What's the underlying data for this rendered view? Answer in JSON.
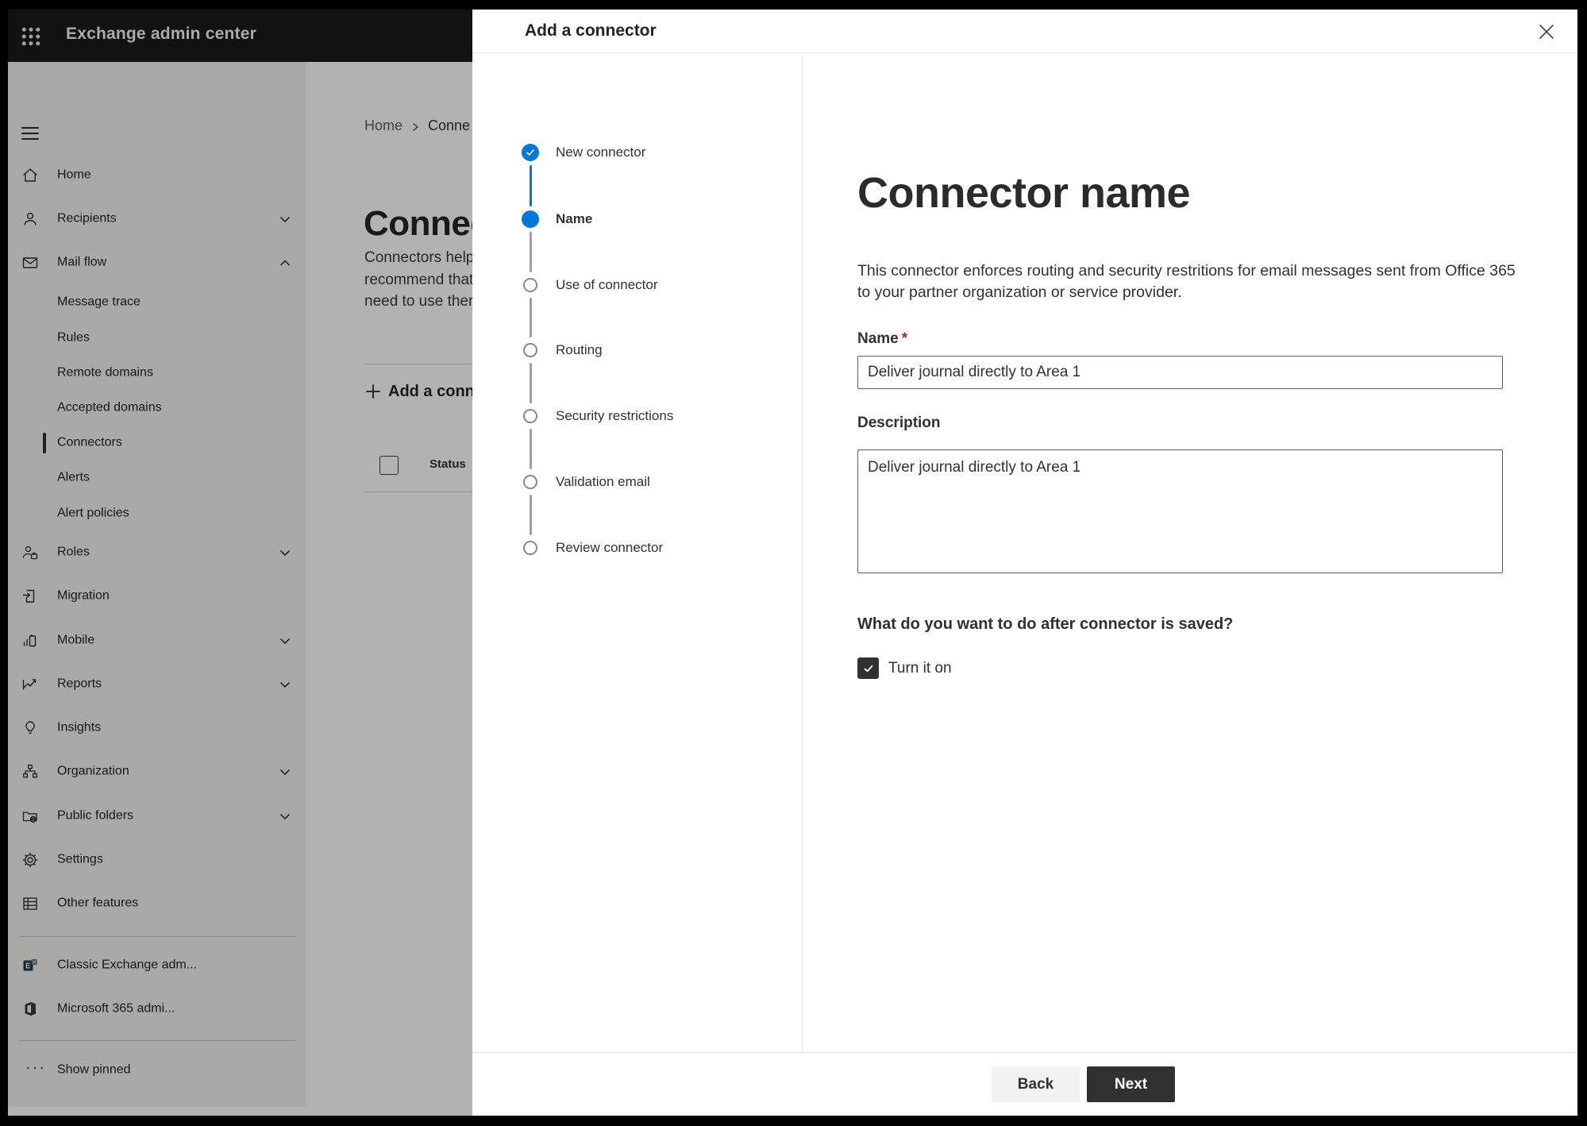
{
  "topbar": {
    "title": "Exchange admin center"
  },
  "sidebar": {
    "nav": [
      {
        "label": "Home"
      },
      {
        "label": "Recipients"
      },
      {
        "label": "Mail flow"
      },
      {
        "label": "Message trace"
      },
      {
        "label": "Rules"
      },
      {
        "label": "Remote domains"
      },
      {
        "label": "Accepted domains"
      },
      {
        "label": "Connectors",
        "selected": true
      },
      {
        "label": "Alerts"
      },
      {
        "label": "Alert policies"
      },
      {
        "label": "Roles"
      },
      {
        "label": "Migration"
      },
      {
        "label": "Mobile"
      },
      {
        "label": "Reports"
      },
      {
        "label": "Insights"
      },
      {
        "label": "Organization"
      },
      {
        "label": "Public folders"
      },
      {
        "label": "Settings"
      },
      {
        "label": "Other features"
      },
      {
        "label": "Classic Exchange adm..."
      },
      {
        "label": "Microsoft 365 admi..."
      },
      {
        "label": "Show pinned"
      }
    ]
  },
  "main": {
    "breadcrumb": [
      "Home",
      "Conne"
    ],
    "title": "Connec",
    "description_lines": [
      "Connectors help",
      "recommend that",
      "need to use ther"
    ],
    "add_button_label": "Add a conn",
    "status_header": "Status"
  },
  "dialog": {
    "title": "Add a connector",
    "steps": [
      {
        "label": "New connector",
        "state": "completed"
      },
      {
        "label": "Name",
        "state": "active"
      },
      {
        "label": "Use of connector",
        "state": "upcoming"
      },
      {
        "label": "Routing",
        "state": "upcoming"
      },
      {
        "label": "Security restrictions",
        "state": "upcoming"
      },
      {
        "label": "Validation email",
        "state": "upcoming"
      },
      {
        "label": "Review connector",
        "state": "upcoming"
      }
    ],
    "content": {
      "heading": "Connector name",
      "intro_lines": [
        "This connector enforces routing and security restritions for email messages sent from Office 365",
        "to your partner organization or service provider."
      ],
      "name_label": "Name",
      "required_marker": "*",
      "name_value": "Deliver journal directly to Area 1",
      "description_label": "Description",
      "description_value": "Deliver journal directly to Area 1",
      "question": "What do you want to do after connector is saved?",
      "turn_on_label": "Turn it on",
      "turn_on_checked": true
    },
    "footer": {
      "back_label": "Back",
      "next_label": "Next"
    }
  },
  "icons": {
    "waffle-icon": "3x3 dot grid",
    "hamburger-icon": "three lines",
    "close-icon": "x",
    "checkmark-icon": "check",
    "plus-icon": "+",
    "chevron-icons": "v / ^ / >"
  },
  "colors": {
    "accent_blue": "#0078d4",
    "step_upcoming_ring": "#8a8886",
    "next_button_bg": "#323130",
    "back_button_bg": "#f3f2f1",
    "required_red": "#a4262c",
    "topbar_bg": "#1a1a1a",
    "overlay": "rgba(0,0,0,0.30)"
  }
}
